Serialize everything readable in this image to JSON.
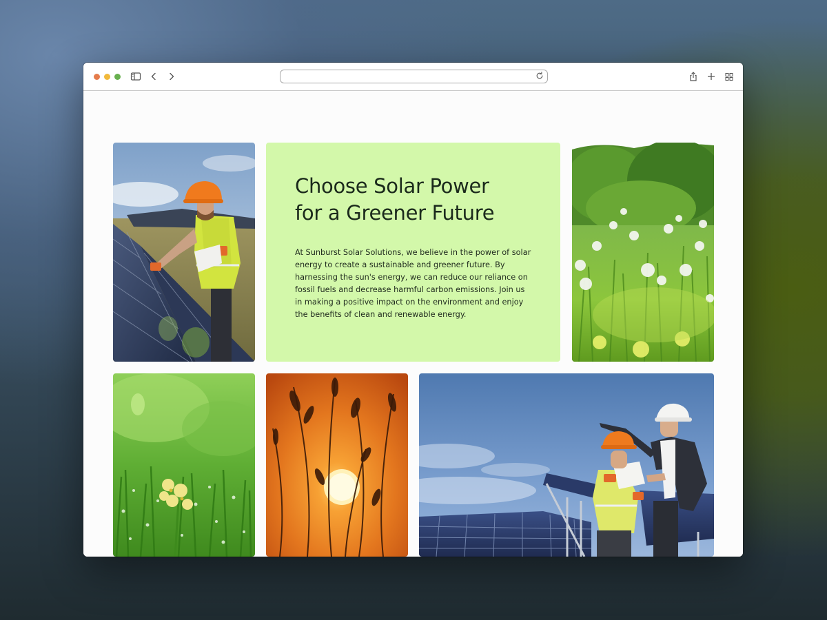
{
  "browser": {
    "address_value": "",
    "icons": [
      "close-dot",
      "minimize-dot",
      "zoom-dot",
      "sidebar-icon",
      "back-icon",
      "forward-icon",
      "reload-icon",
      "share-icon",
      "new-tab-icon",
      "tab-overview-icon"
    ]
  },
  "hero": {
    "title_line1": "Choose Solar Power",
    "title_line2": "for a Greener Future",
    "body": "At Sunburst Solar Solutions, we believe in the power of solar energy to create a sustainable and greener future. By harnessing the sun's energy, we can reduce our reliance on fossil fuels and decrease harmful carbon emissions. Join us in making a positive impact on the environment and enjoy the benefits of clean and renewable energy.",
    "background_color": "#d3f8aa"
  },
  "images": [
    "photo-worker-installing-solar-panels",
    "photo-dandelion-meadow",
    "photo-dewy-grass-yellow-flower",
    "photo-sunset-grass-silhouette",
    "photo-engineers-at-solar-farm"
  ]
}
